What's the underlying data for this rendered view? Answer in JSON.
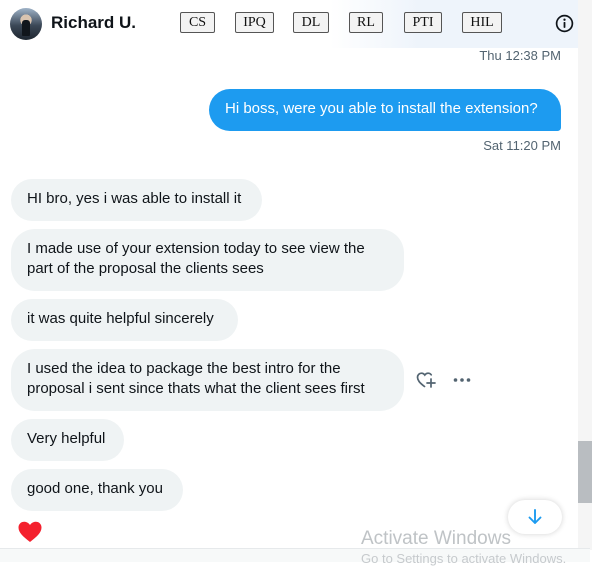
{
  "header": {
    "name": "Richard U.",
    "chips": [
      "CS",
      "IPQ",
      "DL",
      "RL",
      "PTI",
      "HIL"
    ]
  },
  "messages": {
    "ts_top": "Thu 12:38 PM",
    "outgoing_1": "Hi boss, were you able to install the extension?",
    "ts_outgoing_1": "Sat 11:20 PM",
    "incoming_1": "HI bro, yes i was able to install it",
    "incoming_2_line1": "I made use of your extension today to see view the",
    "incoming_2_line2": "part of the proposal the clients sees",
    "incoming_3": "it was quite helpful sincerely",
    "incoming_4_line1": "I used the idea to package the best intro for the",
    "incoming_4_line2": "proposal i sent since thats what the client sees first",
    "incoming_5": "Very helpful",
    "incoming_6": "good one, thank you"
  },
  "watermark": {
    "title": "Activate Windows",
    "subtitle": "Go to Settings to activate Windows."
  },
  "icons": {
    "info": "info-icon",
    "react": "add-reaction-icon",
    "more": "more-icon",
    "heart": "heart-icon",
    "scroll_down": "arrow-down-icon"
  },
  "colors": {
    "outgoing_bubble": "#1d9bf0",
    "incoming_bubble": "#eff3f4",
    "heart": "#f91880",
    "accent": "#1d9bf0"
  }
}
